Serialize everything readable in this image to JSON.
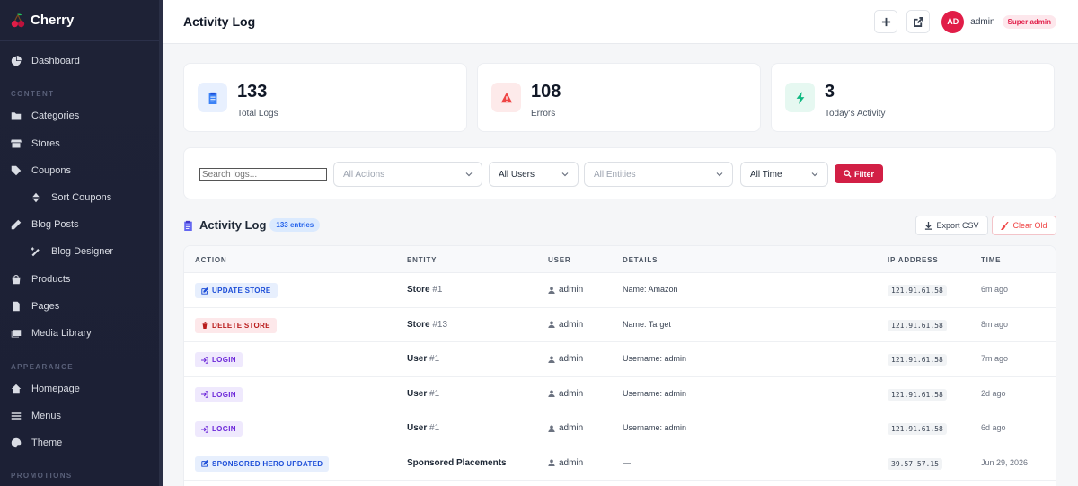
{
  "brand": {
    "name": "Cherry"
  },
  "sidebar": {
    "items": [
      {
        "label": "Dashboard",
        "icon": "chart-pie-icon"
      },
      {
        "label": "Categories",
        "icon": "folder-icon"
      },
      {
        "label": "Stores",
        "icon": "store-icon"
      },
      {
        "label": "Coupons",
        "icon": "tags-icon"
      },
      {
        "label": "Sort Coupons",
        "icon": "sort-icon"
      },
      {
        "label": "Blog Posts",
        "icon": "pen-icon"
      },
      {
        "label": "Blog Designer",
        "icon": "magic-wand-icon"
      },
      {
        "label": "Products",
        "icon": "bag-icon"
      },
      {
        "label": "Pages",
        "icon": "file-icon"
      },
      {
        "label": "Media Library",
        "icon": "images-icon"
      },
      {
        "label": "Homepage",
        "icon": "home-icon"
      },
      {
        "label": "Menus",
        "icon": "bars-icon"
      },
      {
        "label": "Theme",
        "icon": "palette-icon"
      }
    ],
    "sections": {
      "content": "CONTENT",
      "appearance": "APPEARANCE",
      "promotions": "PROMOTIONS"
    }
  },
  "header": {
    "title": "Activity Log",
    "user": {
      "initials": "AD",
      "name": "admin",
      "role": "Super admin"
    }
  },
  "stats": [
    {
      "value": "133",
      "label": "Total Logs",
      "icon": "clipboard-icon",
      "color": "#3b82f6",
      "bg": "#e8f0fe"
    },
    {
      "value": "108",
      "label": "Errors",
      "icon": "warning-icon",
      "color": "#ef4444",
      "bg": "#fdeaea"
    },
    {
      "value": "3",
      "label": "Today's Activity",
      "icon": "bolt-icon",
      "color": "#10b981",
      "bg": "#e6f8f1"
    }
  ],
  "filters": {
    "search_placeholder": "Search logs...",
    "actions": "All Actions",
    "users": "All Users",
    "entities": "All Entities",
    "time": "All Time",
    "filter_label": "Filter"
  },
  "log": {
    "title": "Activity Log",
    "entries": "133 entries",
    "export_label": "Export CSV",
    "clear_label": "Clear Old"
  },
  "table": {
    "columns": [
      "ACTION",
      "ENTITY",
      "USER",
      "DETAILS",
      "IP ADDRESS",
      "TIME"
    ],
    "rows": [
      {
        "action": "UPDATE STORE",
        "type": "update",
        "entity": "Store",
        "entity_id": "#1",
        "user": "admin",
        "details": "Name: Amazon",
        "ip": "121.91.61.58",
        "time": "6m ago"
      },
      {
        "action": "DELETE STORE",
        "type": "delete",
        "entity": "Store",
        "entity_id": "#13",
        "user": "admin",
        "details": "Name: Target",
        "ip": "121.91.61.58",
        "time": "8m ago"
      },
      {
        "action": "LOGIN",
        "type": "login",
        "entity": "User",
        "entity_id": "#1",
        "user": "admin",
        "details": "Username: admin",
        "ip": "121.91.61.58",
        "time": "7m ago"
      },
      {
        "action": "LOGIN",
        "type": "login",
        "entity": "User",
        "entity_id": "#1",
        "user": "admin",
        "details": "Username: admin",
        "ip": "121.91.61.58",
        "time": "2d ago"
      },
      {
        "action": "LOGIN",
        "type": "login",
        "entity": "User",
        "entity_id": "#1",
        "user": "admin",
        "details": "Username: admin",
        "ip": "121.91.61.58",
        "time": "6d ago"
      },
      {
        "action": "SPONSORED HERO UPDATED",
        "type": "update",
        "entity": "Sponsored Placements",
        "entity_id": "",
        "user": "admin",
        "details": "—",
        "ip": "39.57.57.15",
        "time": "Jun 29, 2026"
      }
    ]
  }
}
